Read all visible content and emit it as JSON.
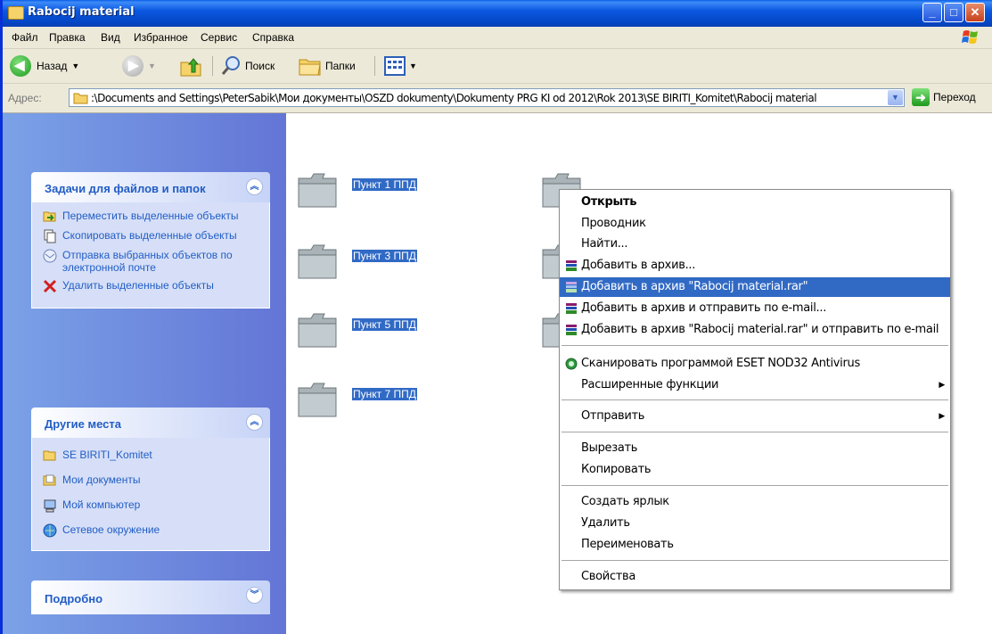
{
  "window": {
    "title": "Rabocij material",
    "min_label": "_",
    "max_label": "□",
    "close_label": "✕"
  },
  "menubar": [
    "Файл",
    "Правка",
    "Вид",
    "Избранное",
    "Сервис",
    "Справка"
  ],
  "toolbar": {
    "back": "Назад",
    "search": "Поиск",
    "folders": "Папки"
  },
  "address": {
    "label": "Адрес:",
    "path": ":\\Documents and Settings\\PeterSabik\\Мои документы\\OSZD dokumenty\\Dokumenty PRG KI od 2012\\Rok 2013\\SE BIRITI_Komitet\\Rabocij material",
    "go": "Переход"
  },
  "tasks_panel": {
    "title": "Задачи для файлов и папок",
    "items": [
      "Переместить выделенные объекты",
      "Скопировать выделенные объекты",
      "Отправка выбранных объектов по электронной почте",
      "Удалить выделенные объекты"
    ]
  },
  "places_panel": {
    "title": "Другие места",
    "items": [
      "SE BIRITI_Komitet",
      "Мои документы",
      "Мой компьютер",
      "Сетевое окружение"
    ]
  },
  "details_panel": {
    "title": "Подробно"
  },
  "folders": [
    "Пункт 1 ППД",
    "Пункт 3 ППД",
    "Пункт 5 ППД",
    "Пункт 7 ППД"
  ],
  "context_menu": {
    "open": "Открыть",
    "explorer": "Проводник",
    "find": "Найти...",
    "add_archive": "Добавить в архив...",
    "add_rar": "Добавить в архив \"Rabocij material.rar\"",
    "add_email": "Добавить в архив и отправить по e-mail...",
    "add_rar_email": "Добавить в архив \"Rabocij material.rar\" и отправить по e-mail",
    "scan": "Сканировать программой ESET NOD32 Antivirus",
    "advanced": "Расширенные функции",
    "send_to": "Отправить",
    "cut": "Вырезать",
    "copy": "Копировать",
    "shortcut": "Создать ярлык",
    "delete": "Удалить",
    "rename": "Переименовать",
    "properties": "Свойства"
  },
  "colors": {
    "selection": "#316ac5",
    "task_link": "#215dc6",
    "titlebar": "#0445c4"
  }
}
